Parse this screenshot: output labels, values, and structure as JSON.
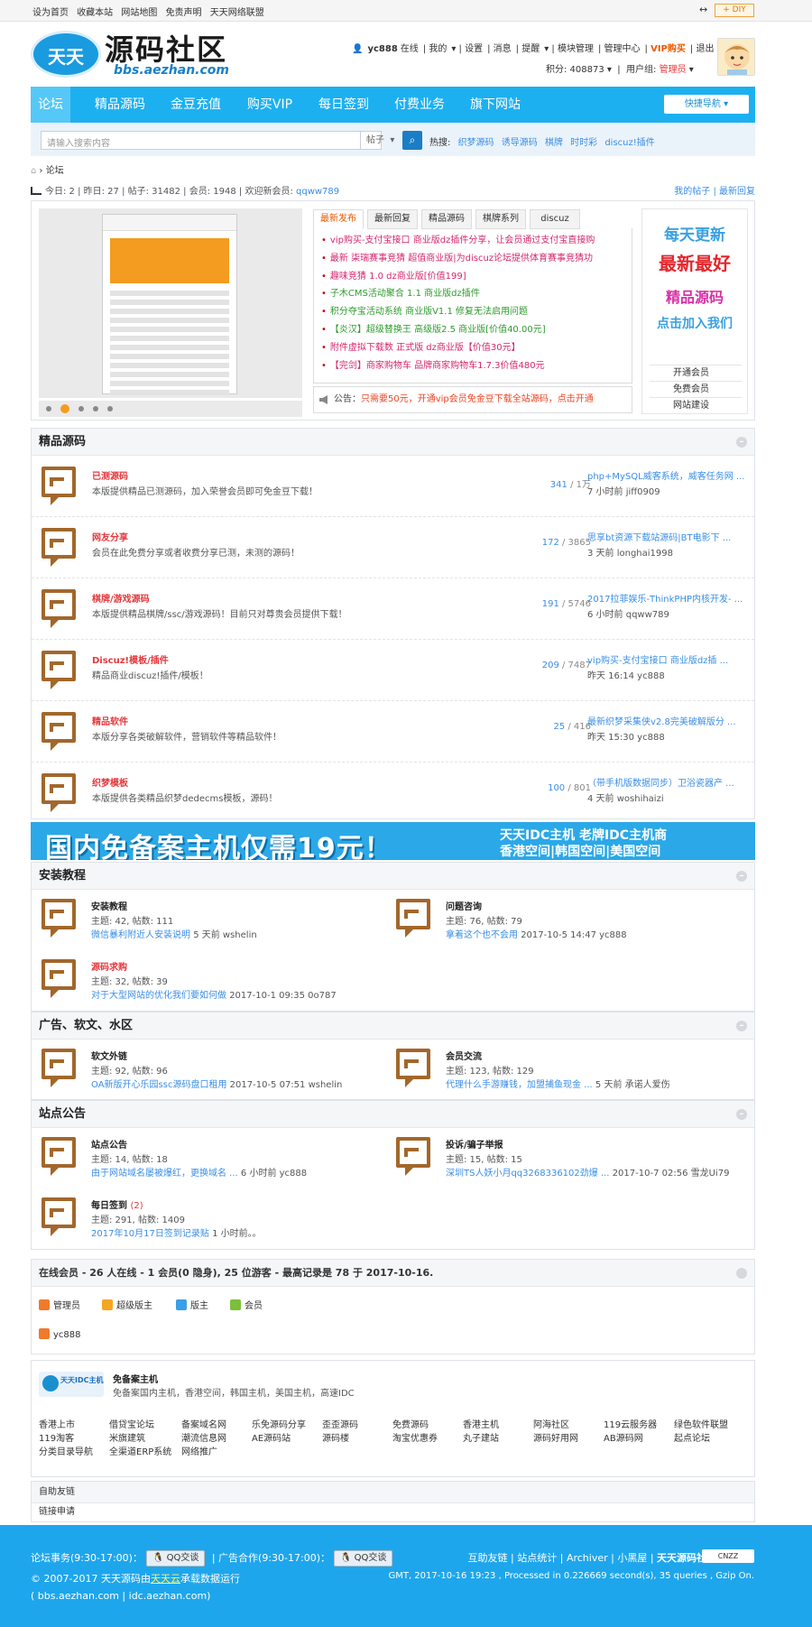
{
  "topbar": {
    "links": [
      "设为首页",
      "收藏本站",
      "网站地图",
      "免责声明",
      "天天网络联盟"
    ],
    "diy": "+ DIY"
  },
  "logo": {
    "badge": "天天",
    "title": "源码社区",
    "url": "bbs.aezhan.com"
  },
  "user": {
    "name": "yc888",
    "status": "在线",
    "items": [
      "我的",
      "设置",
      "消息",
      "提醒",
      "模块管理",
      "管理中心"
    ],
    "vip": "VIP购买",
    "logout": "退出",
    "points_label": "积分: 408873",
    "group_label": "用户组:",
    "group": "管理员"
  },
  "nav": {
    "items": [
      "论坛",
      "精品源码",
      "金豆充值",
      "购买VIP",
      "每日签到",
      "付费业务",
      "旗下网站"
    ],
    "quick": "快捷导航"
  },
  "search": {
    "placeholder": "请输入搜索内容",
    "scope": "帖子",
    "hot_label": "热搜:",
    "hot": [
      "织梦源码",
      "诱导源码",
      "棋牌",
      "时时彩",
      "discuz!插件"
    ]
  },
  "crumb": "论坛",
  "stats": {
    "text": "今日: 2 | 昨日: 27 | 帖子: 31482 | 会员: 1948 | 欢迎新会员: ",
    "newest": "qqww789",
    "links": "我的帖子 | 最新回复"
  },
  "showcase": {
    "tabs": [
      "最新发布",
      "最新回复",
      "精品源码",
      "棋牌系列",
      "discuz"
    ],
    "latest": [
      {
        "text": "vip购买-支付宝接口 商业版dz插件分享，让会员通过支付宝直接购",
        "color": "#d6266e"
      },
      {
        "text": "最新 柒瑞赛事竞猜 超值商业版|为discuz论坛提供体育赛事竞猜功",
        "color": "#d6266e"
      },
      {
        "text": "趣味竞猜 1.0 dz商业版[价值199]",
        "color": "#d6266e"
      },
      {
        "text": "子木CMS活动聚合 1.1 商业版dz插件",
        "color": "#2e9b2e"
      },
      {
        "text": "积分夺宝活动系统 商业版V1.1 修复无法启用问题",
        "color": "#2e9b2e"
      },
      {
        "text": "【炎汉】超级替换王 高级版2.5 商业版[价值40.00元]",
        "color": "#2e9b2e"
      },
      {
        "text": "附件虚拟下载数 正式版 dz商业版【价值30元】",
        "color": "#d6266e"
      },
      {
        "text": "【完剑】商家购物车 品牌商家购物车1.7.3价值480元",
        "color": "#d6266e"
      }
    ],
    "notice_label": "公告：",
    "notice": "只需要50元，开通vip会员免金豆下载全站源码，点击开通",
    "ad": [
      "每天更新",
      "最新最好",
      "精品源码",
      "点击加入我们"
    ],
    "ad_links": [
      "开通会员",
      "免费会员",
      "网站建设"
    ]
  },
  "sections": {
    "jingpin": {
      "title": "精品源码",
      "forums": [
        {
          "name": "已测源码",
          "desc": "本版提供精品已测源码，加入荣誉会员即可免金豆下载！",
          "today": "341",
          "total": "1万",
          "last_title": "php+MySQL威客系统，威客任务网 ...",
          "last_meta": "7 小时前 jiff0909"
        },
        {
          "name": "网友分享",
          "desc": "会员在此免费分享或者收费分享已测，未测的源码！",
          "today": "172",
          "total": "3865",
          "last_title": "思享bt资源下载站源码|BT电影下 ...",
          "last_meta": "3 天前 longhai1998"
        },
        {
          "name": "棋牌/游戏源码",
          "desc": "本版提供精品棋牌/ssc/游戏源码！目前只对尊贵会员提供下载！",
          "today": "191",
          "total": "5746",
          "last_title": "2017拉菲娱乐-ThinkPHP内核开发- ...",
          "last_meta": "6 小时前 qqww789"
        },
        {
          "name": "Discuz!模板/插件",
          "desc": "精品商业discuz!插件/模板！",
          "today": "209",
          "total": "7487",
          "last_title": "vip购买-支付宝接口 商业版dz插 ...",
          "last_meta": "昨天 16:14 yc888"
        },
        {
          "name": "精品软件",
          "desc": "本版分享各类破解软件，营销软件等精品软件！",
          "today": "25",
          "total": "416",
          "last_title": "最新织梦采集侠v2.8完美破解版分 ...",
          "last_meta": "昨天 15:30 yc888"
        },
        {
          "name": "织梦模板",
          "desc": "本版提供各类精品织梦dedecms模板，源码！",
          "today": "100",
          "total": "801",
          "last_title": "（带手机版数据同步）卫浴瓷器产 ...",
          "last_meta": "4 天前 woshihaizi"
        }
      ]
    },
    "banner": {
      "main": "国内免备案主机仅需19元！",
      "line1": "天天IDC主机 老牌IDC主机商",
      "line2": "香港空间|韩国空间|美国空间"
    },
    "anzhuang": {
      "title": "安装教程",
      "cells": [
        {
          "name": "安装教程",
          "meta": "主题: 42, 帖数: 111",
          "last": "微信暴利附近人安装说明",
          "when": "5 天前 wshelin",
          "red": false
        },
        {
          "name": "问题咨询",
          "meta": "主题: 76, 帖数: 79",
          "last": "拿着这个也不会用",
          "when": "2017-10-5 14:47 yc888",
          "red": false
        },
        {
          "name": "源码求购",
          "meta": "主题: 32, 帖数: 39",
          "last": "对于大型网站的优化我们要如何做",
          "when": "2017-10-1 09:35 0o787",
          "red": true
        }
      ]
    },
    "guanggao": {
      "title": "广告、软文、水区",
      "cells": [
        {
          "name": "软文外链",
          "meta": "主题: 92, 帖数: 96",
          "last": "OA新版开心乐园ssc源码盘口租用",
          "when": "2017-10-5 07:51 wshelin",
          "red": false
        },
        {
          "name": "会员交流",
          "meta": "主题: 123, 帖数: 129",
          "last": "代理什么手游赚钱，加盟捕鱼现金 ...",
          "when": "5 天前 承诺人爱伤",
          "red": false
        }
      ]
    },
    "zhandian": {
      "title": "站点公告",
      "cells": [
        {
          "name": "站点公告",
          "meta": "主题: 14, 帖数: 18",
          "last": "由于网站域名屡被爆红，更换域名 ...",
          "when": "6 小时前 yc888",
          "red": false
        },
        {
          "name": "投诉/骗子举报",
          "meta": "主题: 15, 帖数: 15",
          "last": "深圳TS人妖小月qq3268336102劲爆 ...",
          "when": "2017-10-7 02:56 雪龙Ui79",
          "red": false
        },
        {
          "name": "每日签到",
          "badge": "(2)",
          "meta": "主题: 291, 帖数: 1409",
          "last": "2017年10月17日签到记录贴",
          "when": "1 小时前。。",
          "red": false
        }
      ]
    }
  },
  "online": {
    "title": "在线会员 - 26 人在线 - 1 会员(0 隐身), 25 位游客 - 最高记录是 78 于 2017-10-16.",
    "legend": [
      {
        "label": "管理员",
        "color": "#f07a2b"
      },
      {
        "label": "超级版主",
        "color": "#f5a623"
      },
      {
        "label": "版主",
        "color": "#3a9ee6"
      },
      {
        "label": "会员",
        "color": "#7bbf3a"
      }
    ],
    "user": "yc888"
  },
  "links": {
    "logo_text": "天天IDC主机",
    "name": "免备案主机",
    "desc": "免备案国内主机，香港空间，韩国主机，美国主机，高速IDC",
    "items": [
      "香港上市",
      "借贷宝论坛",
      "备案域名网",
      "乐免源码分享",
      "歪歪源码",
      "免费源码",
      "香港主机",
      "阿海社区",
      "119云服务器",
      "绿色软件联盟",
      "119淘客",
      "米旗建筑",
      "潮流信息网",
      "AE源码站",
      "源码楼",
      "淘宝优惠券",
      "丸子建站",
      "源码好用网",
      "AB源码网",
      "起点论坛",
      "分类目录导航",
      "全渠道ERP系统",
      "网络推广"
    ]
  },
  "self": {
    "title": "自助友链",
    "apply": "链接申请"
  },
  "footer": {
    "l1a": "论坛事务(9:30-17:00)：",
    "qq": "QQ交谈",
    "l1b": "| 广告合作(9:30-17:00)：",
    "l2a": "© 2007-2017 天天源码由",
    "l2b": "天天云",
    "l2c": "承载数据运行",
    "l3": "( bbs.aezhan.com | idc.aezhan.com)",
    "r1": "互助友链 | 站点统计 | Archiver | 小黑屋 |",
    "r1b": "天天源码社区",
    "badge": "CNZZ",
    "r2": "GMT, 2017-10-16 19:23 , Processed in 0.226669 second(s), 35 queries , Gzip On."
  }
}
